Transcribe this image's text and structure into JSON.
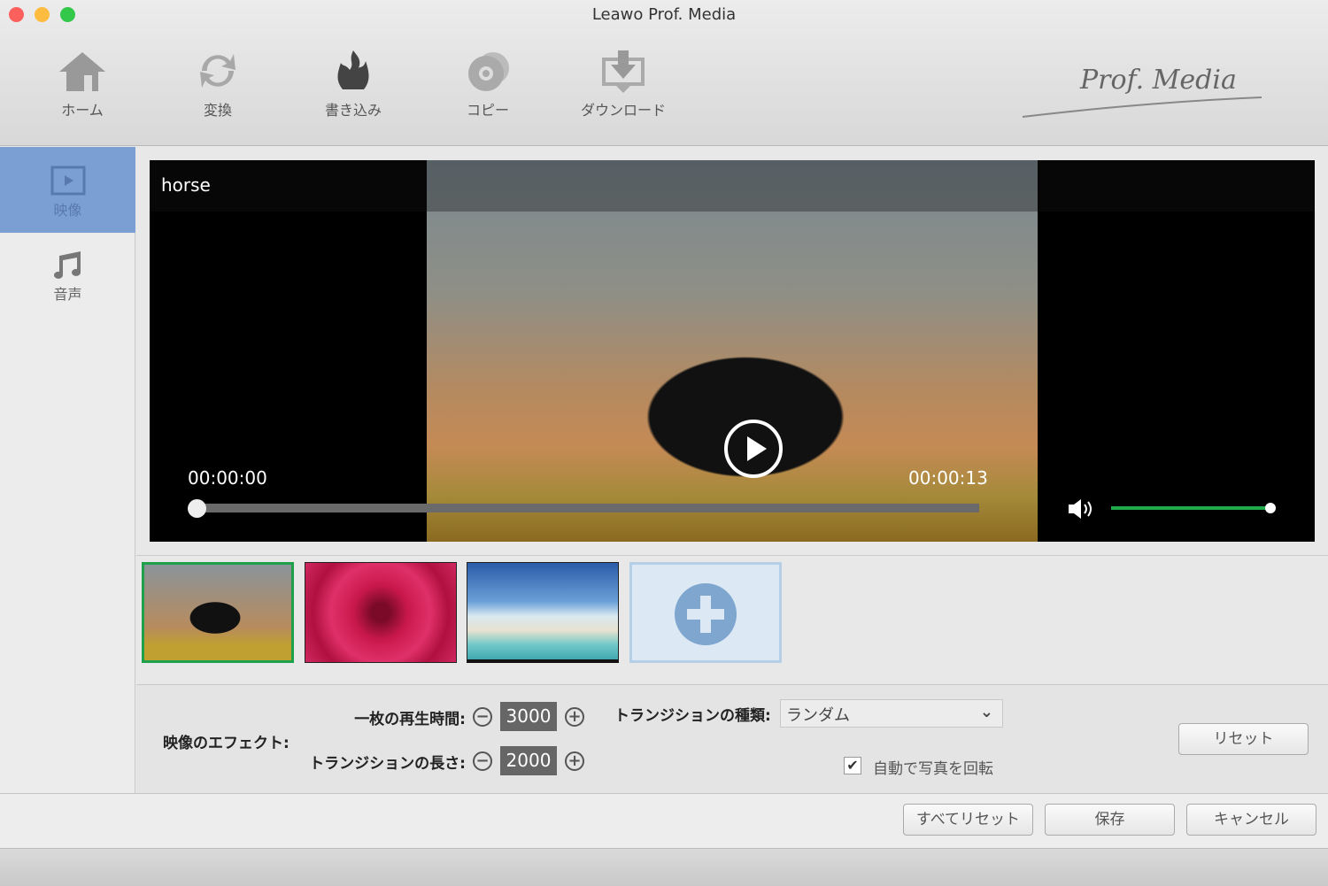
{
  "window": {
    "title": "Leawo Prof. Media"
  },
  "toolbar": [
    {
      "label": "ホーム"
    },
    {
      "label": "変換"
    },
    {
      "label": "書き込み"
    },
    {
      "label": "コピー"
    },
    {
      "label": "ダウンロード"
    }
  ],
  "logo": "Prof. Media",
  "sidebar": [
    {
      "label": "映像",
      "selected": true
    },
    {
      "label": "音声"
    }
  ],
  "player": {
    "title": "horse",
    "current_time": "00:00:00",
    "total_time": "00:00:13",
    "progress": 0,
    "volume": 1.0
  },
  "thumbnails": [
    {
      "name": "horse",
      "selected": true
    },
    {
      "name": "rose"
    },
    {
      "name": "beach"
    }
  ],
  "effects": {
    "label": "映像のエフェクト:",
    "duration_label": "一枚の再生時間:",
    "duration_value": "3000",
    "transition_length_label": "トランジションの長さ:",
    "transition_length_value": "2000",
    "transition_type_label": "トランジションの種類:",
    "transition_type_value": "ランダム",
    "auto_rotate_label": "自動で写真を回転",
    "auto_rotate_checked": true,
    "reset_label": "リセット"
  },
  "footer": {
    "reset_all": "すべてリセット",
    "save": "保存",
    "cancel": "キャンセル"
  }
}
